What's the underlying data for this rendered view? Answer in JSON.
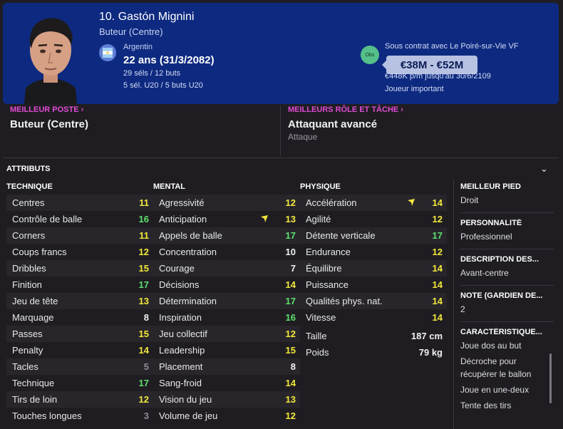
{
  "header": {
    "name": "10. Gastón Mignini",
    "role": "Buteur (Centre)",
    "nation": "Argentin",
    "age": "22 ans (31/3/2082)",
    "caps": "29 séls / 12 buts",
    "u20_caps": "5 sél. U20 / 5 buts U20",
    "obs_label": "Obs",
    "contract": "Sous contrat avec Le Poiré-sur-Vie VF",
    "value": "€38M - €52M",
    "wage": "€448K p/m jusqu'au 30/6/2109",
    "status": "Joueur important"
  },
  "best": {
    "position_label": "MEILLEUR POSTE",
    "position_value": "Buteur (Centre)",
    "role_label": "MEILLEURS RÔLE ET TÂCHE",
    "role_value": "Attaquant avancé",
    "role_duty": "Attaque"
  },
  "attributes": {
    "title": "ATTRIBUTS",
    "technical_title": "TECHNIQUE",
    "mental_title": "MENTAL",
    "physical_title": "PHYSIQUE",
    "technical": [
      {
        "name": "Centres",
        "value": "11",
        "color": "y"
      },
      {
        "name": "Contrôle de balle",
        "value": "16",
        "color": "g"
      },
      {
        "name": "Corners",
        "value": "11",
        "color": "y"
      },
      {
        "name": "Coups francs",
        "value": "12",
        "color": "y"
      },
      {
        "name": "Dribbles",
        "value": "15",
        "color": "y"
      },
      {
        "name": "Finition",
        "value": "17",
        "color": "g"
      },
      {
        "name": "Jeu de tête",
        "value": "13",
        "color": "y"
      },
      {
        "name": "Marquage",
        "value": "8",
        "color": "w"
      },
      {
        "name": "Passes",
        "value": "15",
        "color": "y"
      },
      {
        "name": "Penalty",
        "value": "14",
        "color": "y"
      },
      {
        "name": "Tacles",
        "value": "5",
        "color": "d"
      },
      {
        "name": "Technique",
        "value": "17",
        "color": "g"
      },
      {
        "name": "Tirs de loin",
        "value": "12",
        "color": "y"
      },
      {
        "name": "Touches longues",
        "value": "3",
        "color": "d"
      }
    ],
    "mental": [
      {
        "name": "Agressivité",
        "value": "12",
        "color": "y"
      },
      {
        "name": "Anticipation",
        "value": "13",
        "color": "y"
      },
      {
        "name": "Appels de balle",
        "value": "17",
        "color": "g"
      },
      {
        "name": "Concentration",
        "value": "10",
        "color": "w"
      },
      {
        "name": "Courage",
        "value": "7",
        "color": "w"
      },
      {
        "name": "Décisions",
        "value": "14",
        "color": "y"
      },
      {
        "name": "Détermination",
        "value": "17",
        "color": "g"
      },
      {
        "name": "Inspiration",
        "value": "16",
        "color": "g"
      },
      {
        "name": "Jeu collectif",
        "value": "12",
        "color": "y"
      },
      {
        "name": "Leadership",
        "value": "15",
        "color": "y"
      },
      {
        "name": "Placement",
        "value": "8",
        "color": "w"
      },
      {
        "name": "Sang-froid",
        "value": "14",
        "color": "y"
      },
      {
        "name": "Vision du jeu",
        "value": "13",
        "color": "y"
      },
      {
        "name": "Volume de jeu",
        "value": "12",
        "color": "y"
      }
    ],
    "physical": [
      {
        "name": "Accélération",
        "value": "14",
        "color": "y"
      },
      {
        "name": "Agilité",
        "value": "12",
        "color": "y"
      },
      {
        "name": "Détente verticale",
        "value": "17",
        "color": "g"
      },
      {
        "name": "Endurance",
        "value": "12",
        "color": "y"
      },
      {
        "name": "Équilibre",
        "value": "14",
        "color": "y"
      },
      {
        "name": "Puissance",
        "value": "14",
        "color": "y"
      },
      {
        "name": "Qualités phys. nat.",
        "value": "14",
        "color": "y"
      },
      {
        "name": "Vitesse",
        "value": "14",
        "color": "y"
      }
    ],
    "height_label": "Taille",
    "height_value": "187 cm",
    "weight_label": "Poids",
    "weight_value": "79 kg"
  },
  "side": {
    "foot_label": "MEILLEUR PIED",
    "foot_value": "Droit",
    "personality_label": "PERSONNALITÉ",
    "personality_value": "Professionnel",
    "description_label": "DESCRIPTION DES...",
    "description_value": "Avant-centre",
    "gk_label": "NOTE (GARDIEN DE...",
    "gk_value": "2",
    "traits_label": "CARACTÉRISTIQUE...",
    "traits": [
      "Joue dos au but",
      "Décroche pour",
      "récupérer le ballon",
      "Joue en une-deux",
      "Tente des tirs"
    ]
  },
  "colors": {
    "header_bg": "#0e2a80",
    "yellow": "#f3e83c",
    "green": "#5ee06d",
    "magenta": "#e04bd4"
  }
}
